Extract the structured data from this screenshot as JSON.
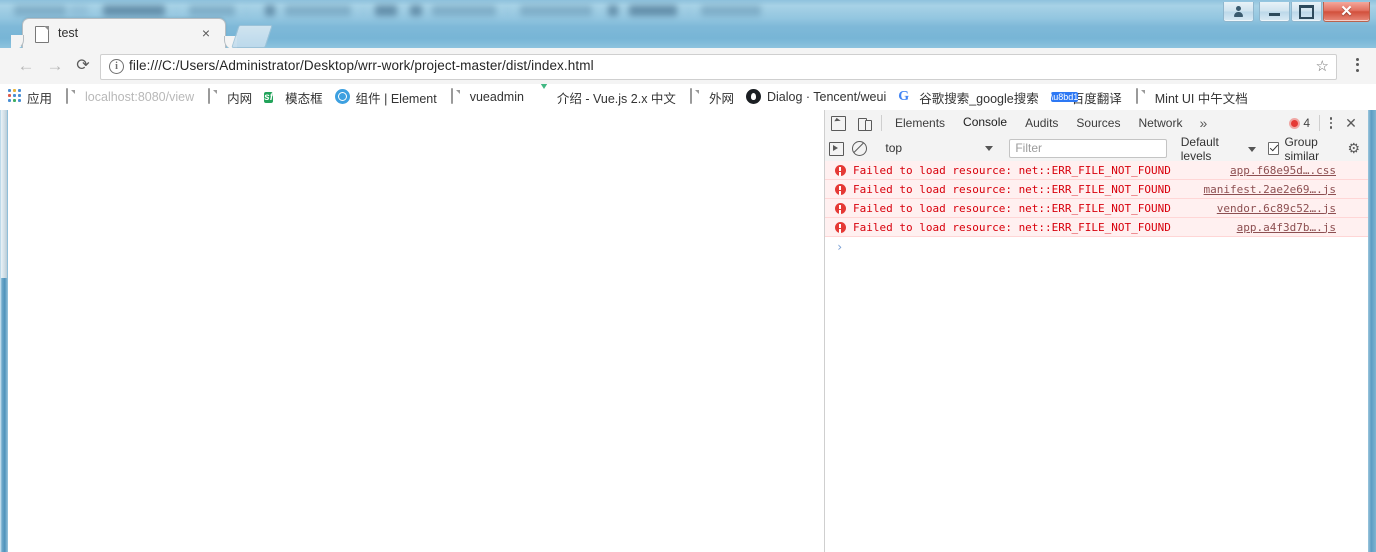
{
  "window": {
    "caption_buttons": [
      {
        "name": "user-account-button",
        "label": ""
      },
      {
        "name": "minimize-button",
        "label": ""
      },
      {
        "name": "maximize-button",
        "label": ""
      },
      {
        "name": "close-button",
        "label": "✕"
      }
    ]
  },
  "tabs": {
    "active": {
      "title": "test",
      "close_label": "×",
      "favicon": "page-icon"
    },
    "new_tab_label": ""
  },
  "toolbar": {
    "back_label": "←",
    "forward_label": "→",
    "reload_label": "⟳",
    "info_label": "i",
    "url": "file:///C:/Users/Administrator/Desktop/wrr-work/project-master/dist/index.html",
    "star_label": "☆",
    "menu_label": ""
  },
  "bookmarks": [
    {
      "label": "应用",
      "icon": "apps-grid-icon",
      "faded": false
    },
    {
      "label": "localhost:8080/view",
      "icon": "page-icon",
      "faded": true
    },
    {
      "label": "内网",
      "icon": "page-icon",
      "faded": false
    },
    {
      "label": "模态框",
      "icon": "sf-icon",
      "faded": false
    },
    {
      "label": "组件 | Element",
      "icon": "element-icon",
      "faded": false
    },
    {
      "label": "vueadmin",
      "icon": "page-icon",
      "faded": false
    },
    {
      "label": "介绍 - Vue.js 2.x 中文",
      "icon": "vue-icon",
      "faded": true
    },
    {
      "label": "外网",
      "icon": "page-icon",
      "faded": false
    },
    {
      "label": "Dialog · Tencent/weui",
      "icon": "github-icon",
      "faded": true
    },
    {
      "label": "谷歌搜索_google搜索",
      "icon": "google-icon",
      "faded": true
    },
    {
      "label": "百度翻译",
      "icon": "baidu-fanyi-icon",
      "faded": false
    },
    {
      "label": "Mint UI 中午文档",
      "icon": "page-icon",
      "faded": false
    }
  ],
  "devtools": {
    "tabs": [
      {
        "label": "Elements",
        "active": false
      },
      {
        "label": "Console",
        "active": true
      },
      {
        "label": "Audits",
        "active": false
      },
      {
        "label": "Sources",
        "active": false
      },
      {
        "label": "Network",
        "active": false
      }
    ],
    "more_tabs_label": "»",
    "error_count": "4",
    "close_label": "✕",
    "filter_bar": {
      "context": "top",
      "filter_placeholder": "Filter",
      "filter_value": "",
      "levels_label": "Default levels",
      "group_similar_label": "Group similar",
      "group_similar_checked": true,
      "settings_label": "⚙"
    },
    "messages": [
      {
        "text": "Failed to load resource: net::ERR_FILE_NOT_FOUND",
        "source": "app.f68e95d….css"
      },
      {
        "text": "Failed to load resource: net::ERR_FILE_NOT_FOUND",
        "source": "manifest.2ae2e69….js"
      },
      {
        "text": "Failed to load resource: net::ERR_FILE_NOT_FOUND",
        "source": "vendor.6c89c52….js"
      },
      {
        "text": "Failed to load resource: net::ERR_FILE_NOT_FOUND",
        "source": "app.a4f3d7b….js"
      }
    ],
    "prompt_caret": "›"
  },
  "colors": {
    "error_red": "#d8000c",
    "error_bg": "#fff0f0",
    "titlebar_blue": "#8fc2dd",
    "close_red": "#d2503c"
  }
}
